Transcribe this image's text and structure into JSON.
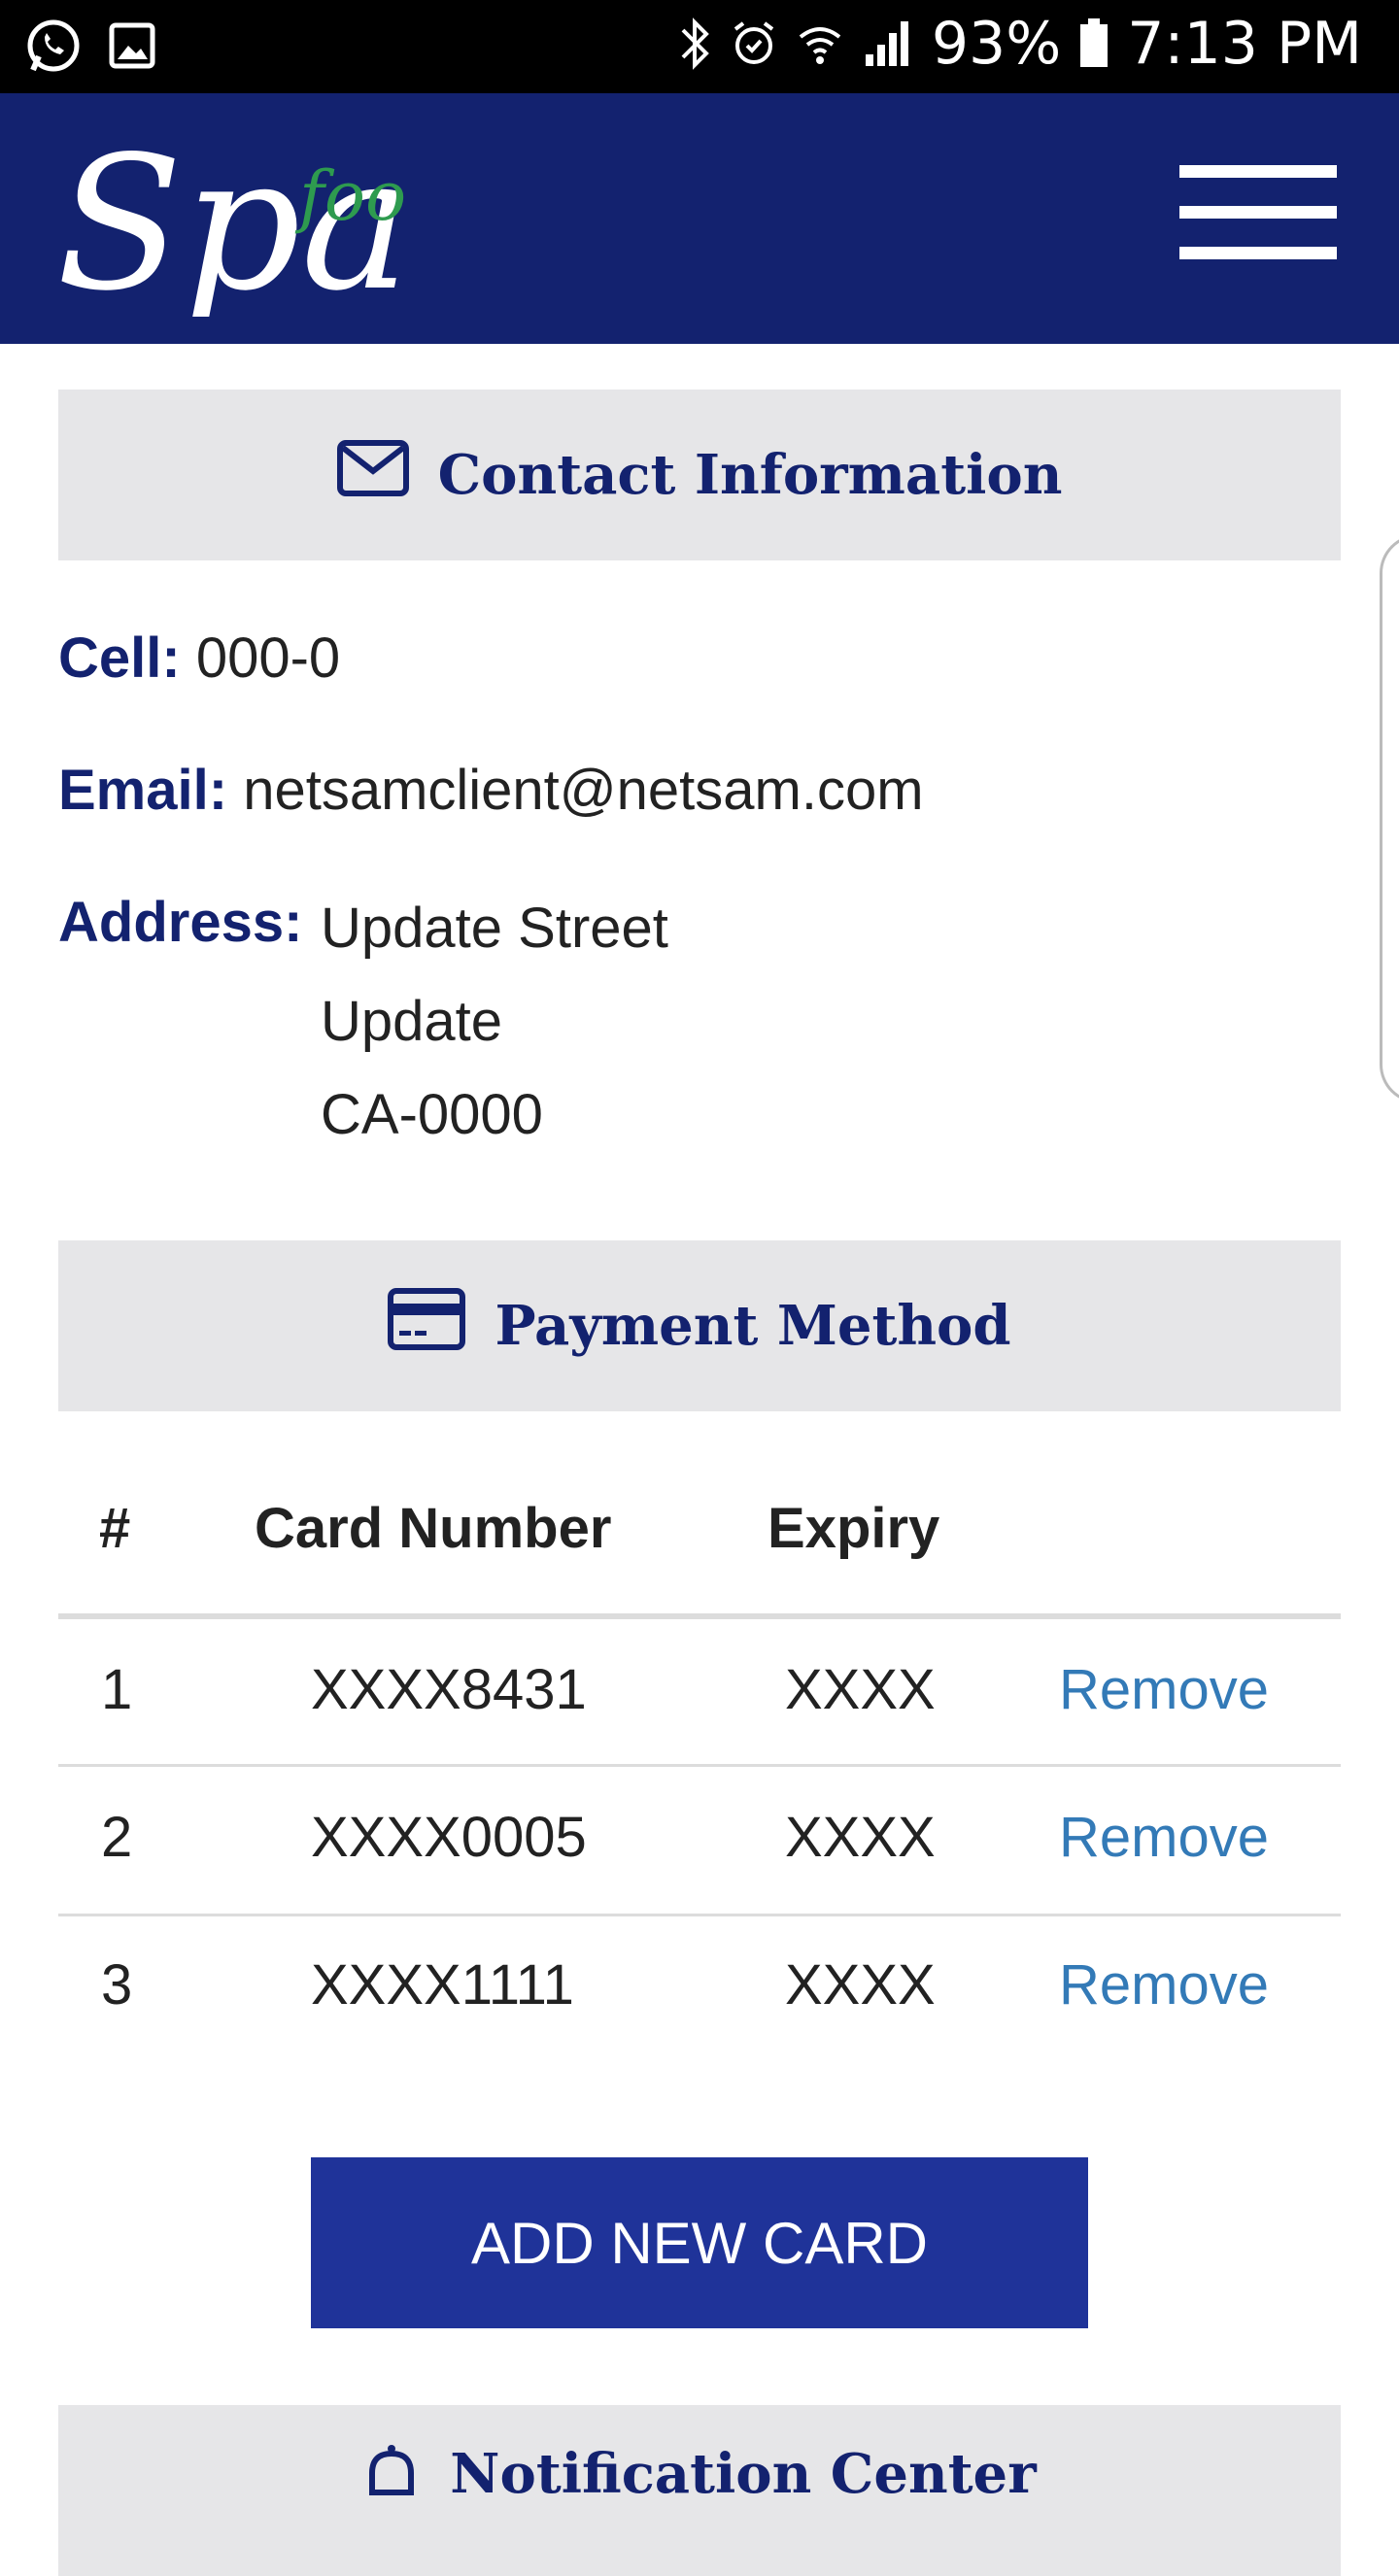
{
  "status_bar": {
    "battery": "93%",
    "time": "7:13 PM"
  },
  "header": {
    "logo_main": "Spa",
    "logo_accent": "foo"
  },
  "contact": {
    "title": "Contact Information",
    "cell_label": "Cell:",
    "cell_value": "000-0",
    "email_label": "Email:",
    "email_value": "netsamclient@netsam.com",
    "address_label": "Address:",
    "address_line1": "Update Street",
    "address_line2": "Update",
    "address_line3": "CA-0000"
  },
  "payment": {
    "title": "Payment Method",
    "columns": [
      "#",
      "Card Number",
      "Expiry"
    ],
    "rows": [
      {
        "num": "1",
        "card": "XXXX8431",
        "expiry": "XXXX",
        "action": "Remove"
      },
      {
        "num": "2",
        "card": "XXXX0005",
        "expiry": "XXXX",
        "action": "Remove"
      },
      {
        "num": "3",
        "card": "XXXX1111",
        "expiry": "XXXX",
        "action": "Remove"
      }
    ],
    "add_button": "ADD NEW CARD"
  },
  "notification": {
    "title": "Notification Center"
  },
  "colors": {
    "brand_navy": "#13226f",
    "button_blue": "#1f3399",
    "link_blue": "#337ab7",
    "accent_green": "#2e9b4f"
  }
}
